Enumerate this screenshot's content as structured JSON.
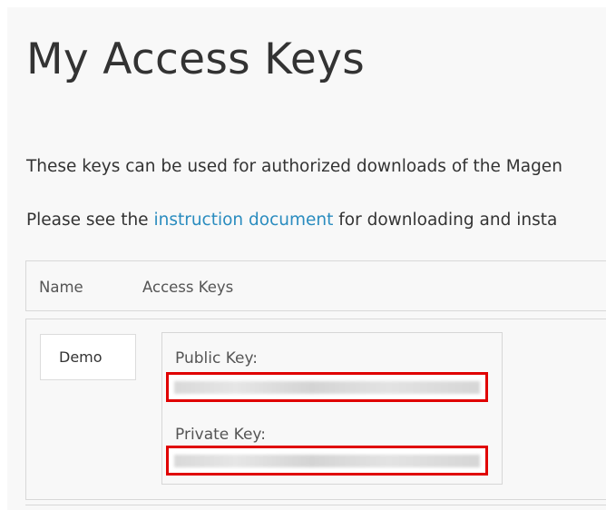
{
  "page": {
    "title": "My Access Keys",
    "intro": "These keys can be used for authorized downloads of the Magen",
    "instruction_prefix": "Please see the ",
    "instruction_link": "instruction document",
    "instruction_suffix": " for downloading and insta"
  },
  "table": {
    "columns": [
      "Name",
      "Access Keys"
    ],
    "rows": [
      {
        "name": "Demo",
        "public_key_label": "Public Key:",
        "public_key_value": "",
        "private_key_label": "Private Key:",
        "private_key_value": ""
      }
    ]
  },
  "colors": {
    "link": "#2a8cbf",
    "highlight_border": "#e00000",
    "background": "#f8f8f8"
  }
}
